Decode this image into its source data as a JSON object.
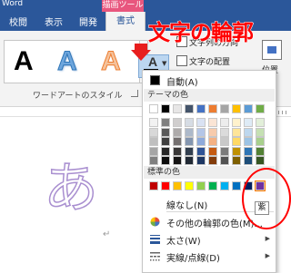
{
  "window": {
    "app_title": "Word",
    "contextual_group": "描画ツール"
  },
  "tabs": [
    {
      "label": "校閲"
    },
    {
      "label": "表示"
    },
    {
      "label": "開発"
    },
    {
      "label": "書式",
      "active": true
    }
  ],
  "ribbon": {
    "wordart_samples": [
      "A",
      "A",
      "A"
    ],
    "group_label": "ワードアートのスタイル",
    "outline_button_letter": "A",
    "text_direction_label": "文字列の方向",
    "text_align_label": "文字の配置",
    "position_label": "位置"
  },
  "annotation": {
    "title": "文字の輪郭",
    "tooltip": "紫"
  },
  "menu": {
    "automatic_label": "自動(A)",
    "theme_header": "テーマの色",
    "standard_header": "標準の色",
    "no_line_label": "線なし(N)",
    "more_colors_label": "その他の輪郭の色(M)...",
    "weight_label": "太さ(W)",
    "dashes_label": "実線/点線(D)",
    "theme_top": [
      "#ffffff",
      "#000000",
      "#e7e6e6",
      "#44546a",
      "#4472c4",
      "#ed7d31",
      "#a5a5a5",
      "#ffc000",
      "#5b9bd5",
      "#70ad47"
    ],
    "theme_shades": [
      [
        "#f2f2f2",
        "#7f7f7f",
        "#d0cece",
        "#d6dce4",
        "#d9e2f3",
        "#fbe5d5",
        "#ededed",
        "#fff2cc",
        "#deebf6",
        "#e2efd9"
      ],
      [
        "#d8d8d8",
        "#595959",
        "#aeabab",
        "#adb9ca",
        "#b4c6e7",
        "#f7cbac",
        "#dbdbdb",
        "#fee599",
        "#bdd7ee",
        "#c5e0b3"
      ],
      [
        "#bfbfbf",
        "#3f3f3f",
        "#757070",
        "#8496b0",
        "#8eaadb",
        "#f4b183",
        "#c9c9c9",
        "#ffd965",
        "#9cc3e5",
        "#a8d08d"
      ],
      [
        "#a5a5a5",
        "#262626",
        "#3a3838",
        "#323f4f",
        "#2f5496",
        "#c55a11",
        "#7b7b7b",
        "#bf9000",
        "#2e75b5",
        "#538135"
      ],
      [
        "#7f7f7f",
        "#0c0c0c",
        "#171616",
        "#222a35",
        "#1f3864",
        "#833c0b",
        "#525252",
        "#7f6000",
        "#1e4e79",
        "#375623"
      ]
    ],
    "standard_colors": [
      "#c00000",
      "#ff0000",
      "#ffc000",
      "#ffff00",
      "#92d050",
      "#00b050",
      "#00b0f0",
      "#0070c0",
      "#002060",
      "#7030a0"
    ]
  },
  "document": {
    "text": "あ",
    "paragraph_mark": "↵"
  }
}
